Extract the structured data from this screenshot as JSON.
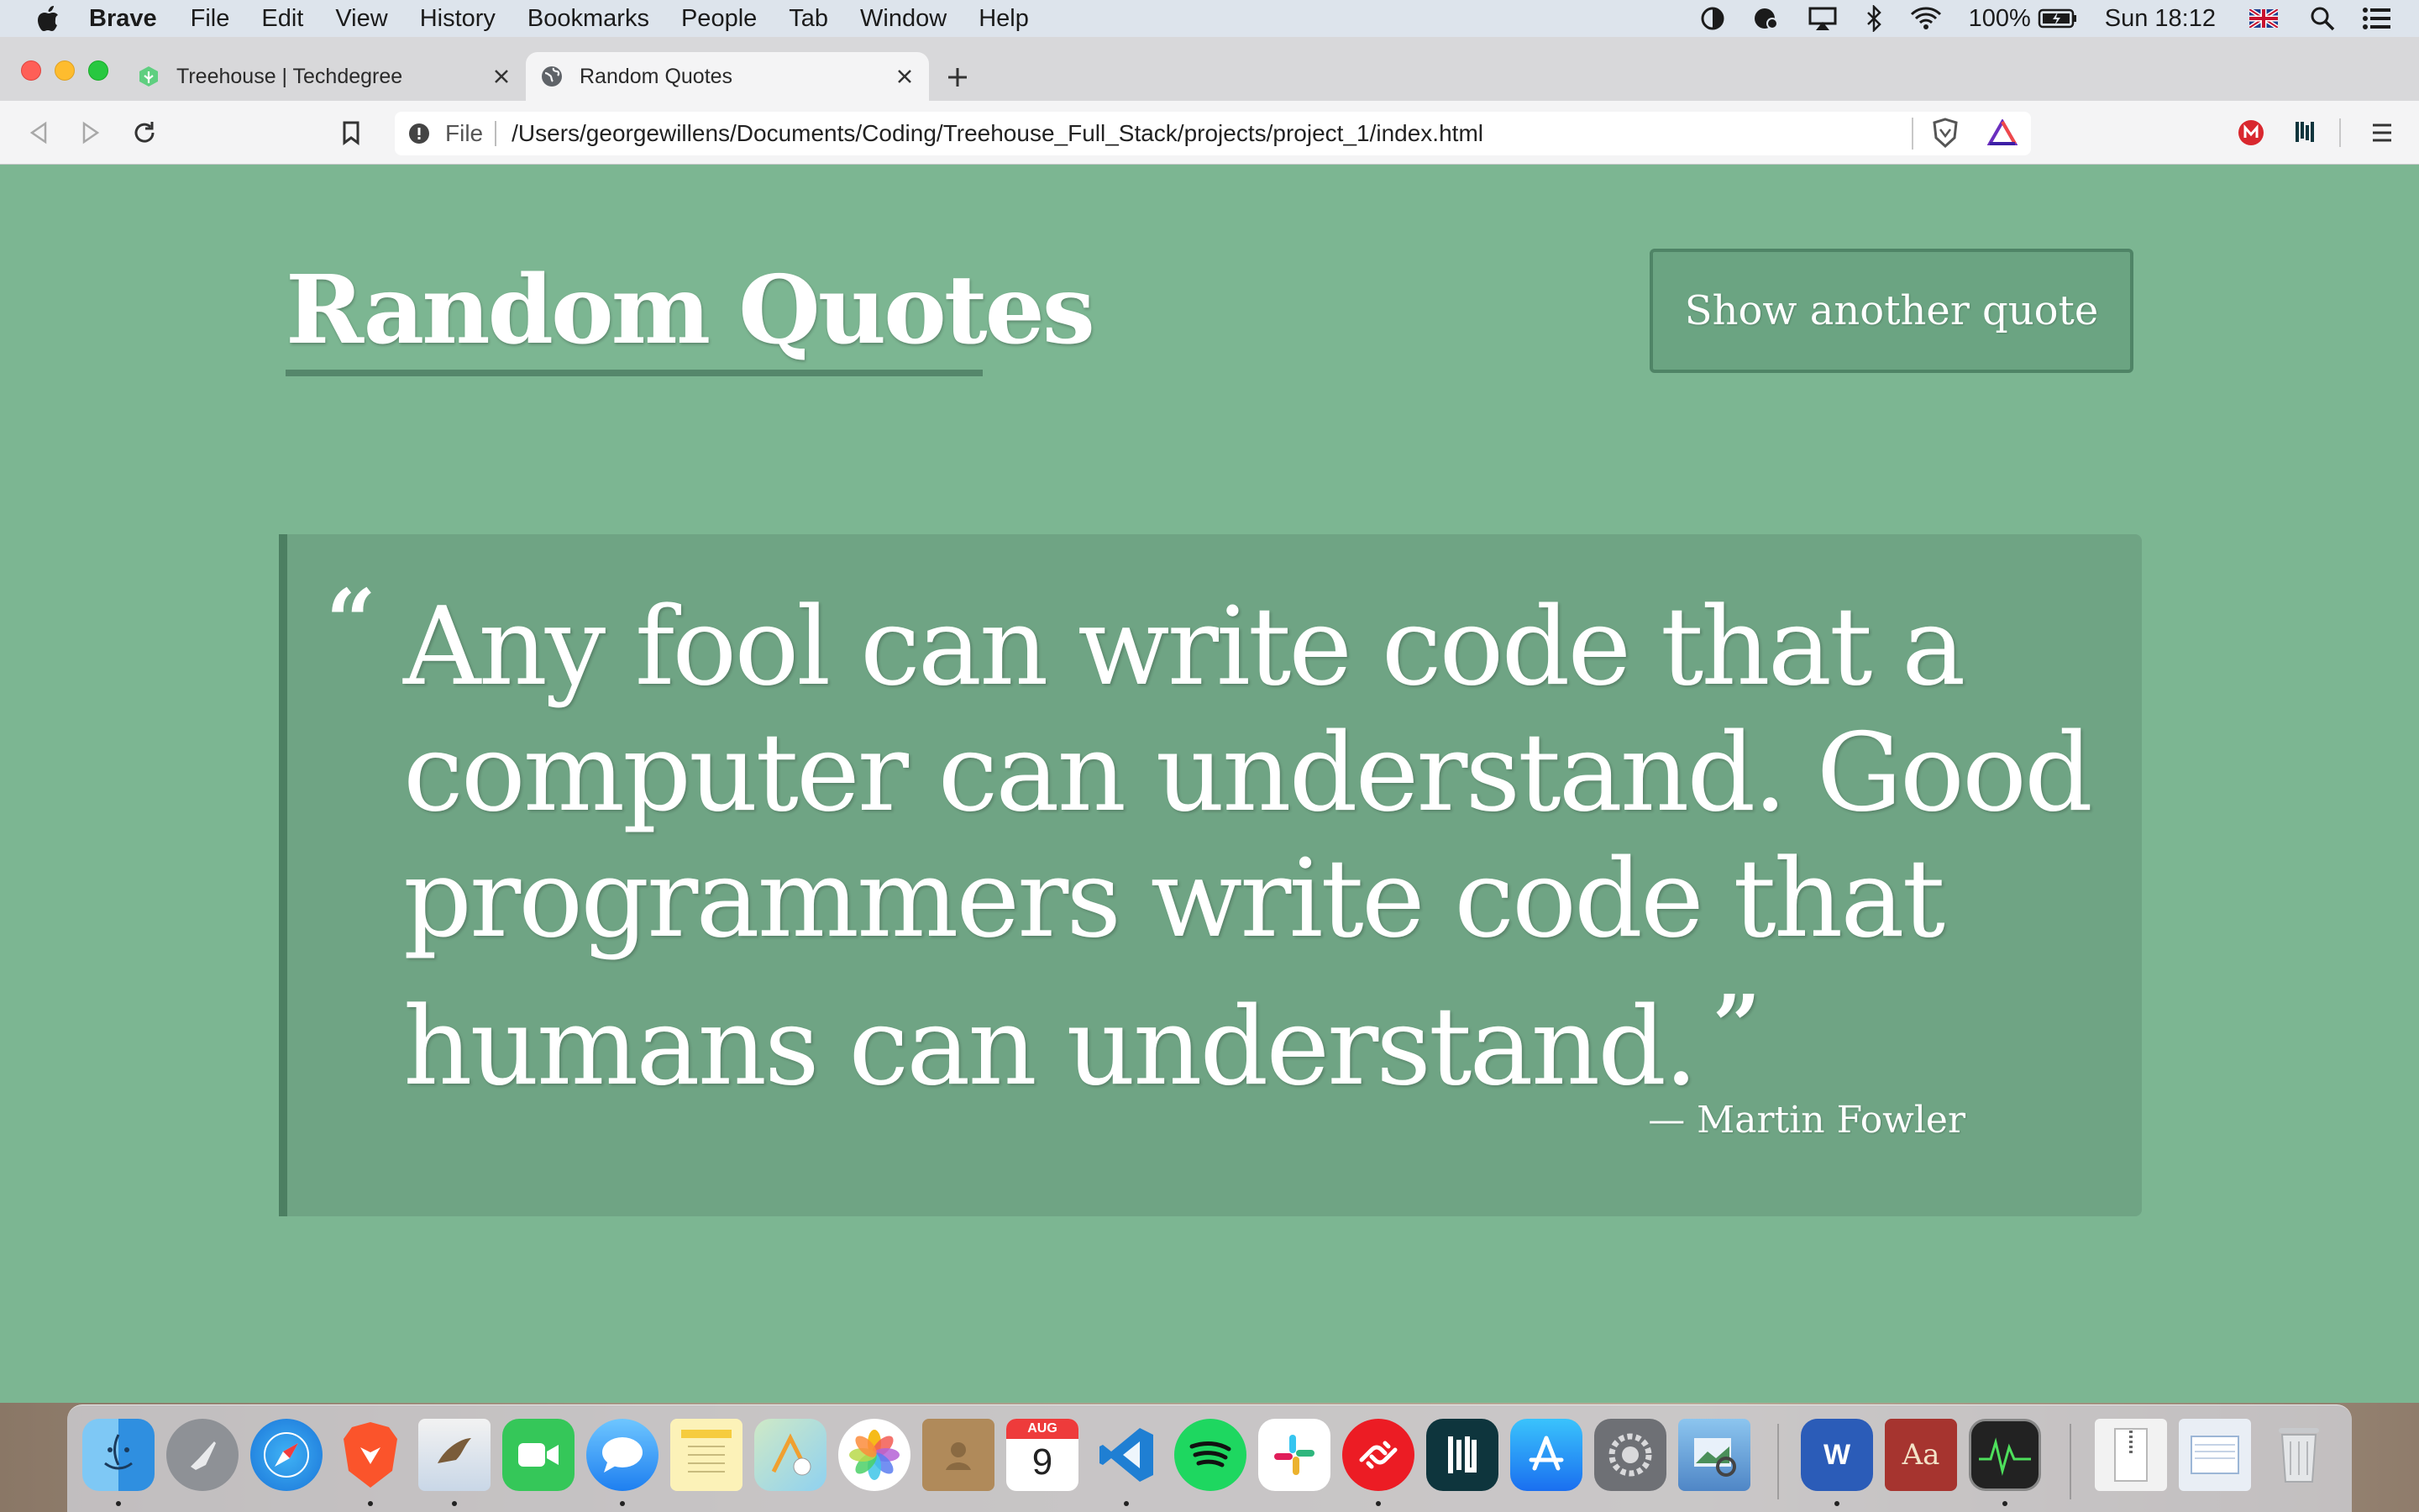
{
  "menubar": {
    "app_name": "Brave",
    "items": [
      "File",
      "Edit",
      "View",
      "History",
      "Bookmarks",
      "People",
      "Tab",
      "Window",
      "Help"
    ],
    "battery": "100%",
    "clock": "Sun 18:12",
    "status_icons": [
      "dark-mode-icon",
      "creative-cloud-icon",
      "airplay-icon",
      "bluetooth-icon",
      "wifi-icon",
      "battery-icon",
      "flag-uk-icon",
      "spotlight-icon",
      "control-center-icon"
    ]
  },
  "tabs": [
    {
      "title": "Treehouse | Techdegree",
      "active": false,
      "icon": "treehouse-favicon"
    },
    {
      "title": "Random Quotes",
      "active": true,
      "icon": "globe-favicon"
    }
  ],
  "toolbar": {
    "scheme_label": "File",
    "url": "/Users/georgewillens/Documents/Coding/Treehouse_Full_Stack/projects/project_1/index.html"
  },
  "page": {
    "heading": "Random Quotes",
    "button_label": "Show another quote",
    "quote": {
      "text": "Any fool can write code that a computer can understand. Good programmers write code that humans can understand.",
      "open_mark": "“",
      "close_mark": "”",
      "author": "— Martin Fowler"
    },
    "colors": {
      "background": "#7cb692",
      "quote_box": "#6fa484",
      "accent_border": "#4c7f62"
    }
  },
  "dock": {
    "apps": [
      "finder",
      "launchpad",
      "safari",
      "brave",
      "preview-mail",
      "facetime",
      "messages",
      "notes",
      "maps",
      "photos",
      "contacts",
      "calendar",
      "vscode",
      "spotify",
      "slack",
      "authy",
      "dashlane",
      "app-store",
      "system-preferences",
      "preview",
      "word",
      "dictionary",
      "activity-monitor",
      "archive",
      "file-browser",
      "trash"
    ],
    "calendar_month": "AUG",
    "calendar_day": "9",
    "dictionary_label": "Aa",
    "word_label": "W"
  }
}
